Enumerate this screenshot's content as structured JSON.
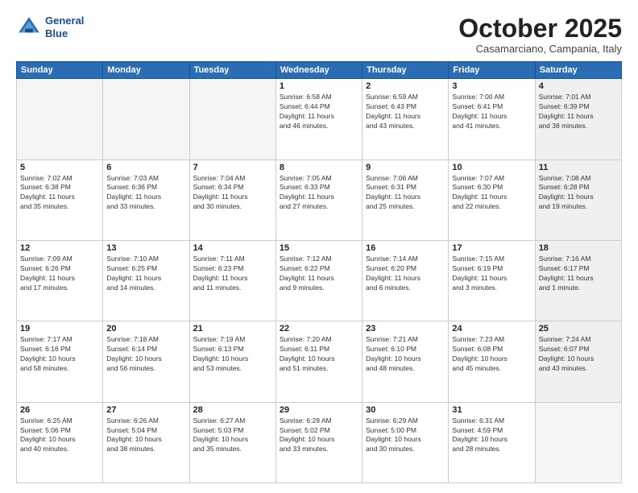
{
  "header": {
    "logo_line1": "General",
    "logo_line2": "Blue",
    "month": "October 2025",
    "location": "Casamarciano, Campania, Italy"
  },
  "days_of_week": [
    "Sunday",
    "Monday",
    "Tuesday",
    "Wednesday",
    "Thursday",
    "Friday",
    "Saturday"
  ],
  "weeks": [
    [
      {
        "day": "",
        "info": "",
        "empty": true
      },
      {
        "day": "",
        "info": "",
        "empty": true
      },
      {
        "day": "",
        "info": "",
        "empty": true
      },
      {
        "day": "1",
        "info": "Sunrise: 6:58 AM\nSunset: 6:44 PM\nDaylight: 11 hours\nand 46 minutes.",
        "shaded": false
      },
      {
        "day": "2",
        "info": "Sunrise: 6:59 AM\nSunset: 6:43 PM\nDaylight: 11 hours\nand 43 minutes.",
        "shaded": false
      },
      {
        "day": "3",
        "info": "Sunrise: 7:00 AM\nSunset: 6:41 PM\nDaylight: 11 hours\nand 41 minutes.",
        "shaded": false
      },
      {
        "day": "4",
        "info": "Sunrise: 7:01 AM\nSunset: 6:39 PM\nDaylight: 11 hours\nand 38 minutes.",
        "shaded": true
      }
    ],
    [
      {
        "day": "5",
        "info": "Sunrise: 7:02 AM\nSunset: 6:38 PM\nDaylight: 11 hours\nand 35 minutes.",
        "shaded": false
      },
      {
        "day": "6",
        "info": "Sunrise: 7:03 AM\nSunset: 6:36 PM\nDaylight: 11 hours\nand 33 minutes.",
        "shaded": false
      },
      {
        "day": "7",
        "info": "Sunrise: 7:04 AM\nSunset: 6:34 PM\nDaylight: 11 hours\nand 30 minutes.",
        "shaded": false
      },
      {
        "day": "8",
        "info": "Sunrise: 7:05 AM\nSunset: 6:33 PM\nDaylight: 11 hours\nand 27 minutes.",
        "shaded": false
      },
      {
        "day": "9",
        "info": "Sunrise: 7:06 AM\nSunset: 6:31 PM\nDaylight: 11 hours\nand 25 minutes.",
        "shaded": false
      },
      {
        "day": "10",
        "info": "Sunrise: 7:07 AM\nSunset: 6:30 PM\nDaylight: 11 hours\nand 22 minutes.",
        "shaded": false
      },
      {
        "day": "11",
        "info": "Sunrise: 7:08 AM\nSunset: 6:28 PM\nDaylight: 11 hours\nand 19 minutes.",
        "shaded": true
      }
    ],
    [
      {
        "day": "12",
        "info": "Sunrise: 7:09 AM\nSunset: 6:26 PM\nDaylight: 11 hours\nand 17 minutes.",
        "shaded": false
      },
      {
        "day": "13",
        "info": "Sunrise: 7:10 AM\nSunset: 6:25 PM\nDaylight: 11 hours\nand 14 minutes.",
        "shaded": false
      },
      {
        "day": "14",
        "info": "Sunrise: 7:11 AM\nSunset: 6:23 PM\nDaylight: 11 hours\nand 11 minutes.",
        "shaded": false
      },
      {
        "day": "15",
        "info": "Sunrise: 7:12 AM\nSunset: 6:22 PM\nDaylight: 11 hours\nand 9 minutes.",
        "shaded": false
      },
      {
        "day": "16",
        "info": "Sunrise: 7:14 AM\nSunset: 6:20 PM\nDaylight: 11 hours\nand 6 minutes.",
        "shaded": false
      },
      {
        "day": "17",
        "info": "Sunrise: 7:15 AM\nSunset: 6:19 PM\nDaylight: 11 hours\nand 3 minutes.",
        "shaded": false
      },
      {
        "day": "18",
        "info": "Sunrise: 7:16 AM\nSunset: 6:17 PM\nDaylight: 11 hours\nand 1 minute.",
        "shaded": true
      }
    ],
    [
      {
        "day": "19",
        "info": "Sunrise: 7:17 AM\nSunset: 6:16 PM\nDaylight: 10 hours\nand 58 minutes.",
        "shaded": false
      },
      {
        "day": "20",
        "info": "Sunrise: 7:18 AM\nSunset: 6:14 PM\nDaylight: 10 hours\nand 56 minutes.",
        "shaded": false
      },
      {
        "day": "21",
        "info": "Sunrise: 7:19 AM\nSunset: 6:13 PM\nDaylight: 10 hours\nand 53 minutes.",
        "shaded": false
      },
      {
        "day": "22",
        "info": "Sunrise: 7:20 AM\nSunset: 6:11 PM\nDaylight: 10 hours\nand 51 minutes.",
        "shaded": false
      },
      {
        "day": "23",
        "info": "Sunrise: 7:21 AM\nSunset: 6:10 PM\nDaylight: 10 hours\nand 48 minutes.",
        "shaded": false
      },
      {
        "day": "24",
        "info": "Sunrise: 7:23 AM\nSunset: 6:08 PM\nDaylight: 10 hours\nand 45 minutes.",
        "shaded": false
      },
      {
        "day": "25",
        "info": "Sunrise: 7:24 AM\nSunset: 6:07 PM\nDaylight: 10 hours\nand 43 minutes.",
        "shaded": true
      }
    ],
    [
      {
        "day": "26",
        "info": "Sunrise: 6:25 AM\nSunset: 5:06 PM\nDaylight: 10 hours\nand 40 minutes.",
        "shaded": false
      },
      {
        "day": "27",
        "info": "Sunrise: 6:26 AM\nSunset: 5:04 PM\nDaylight: 10 hours\nand 38 minutes.",
        "shaded": false
      },
      {
        "day": "28",
        "info": "Sunrise: 6:27 AM\nSunset: 5:03 PM\nDaylight: 10 hours\nand 35 minutes.",
        "shaded": false
      },
      {
        "day": "29",
        "info": "Sunrise: 6:28 AM\nSunset: 5:02 PM\nDaylight: 10 hours\nand 33 minutes.",
        "shaded": false
      },
      {
        "day": "30",
        "info": "Sunrise: 6:29 AM\nSunset: 5:00 PM\nDaylight: 10 hours\nand 30 minutes.",
        "shaded": false
      },
      {
        "day": "31",
        "info": "Sunrise: 6:31 AM\nSunset: 4:59 PM\nDaylight: 10 hours\nand 28 minutes.",
        "shaded": false
      },
      {
        "day": "",
        "info": "",
        "empty": true
      }
    ]
  ]
}
